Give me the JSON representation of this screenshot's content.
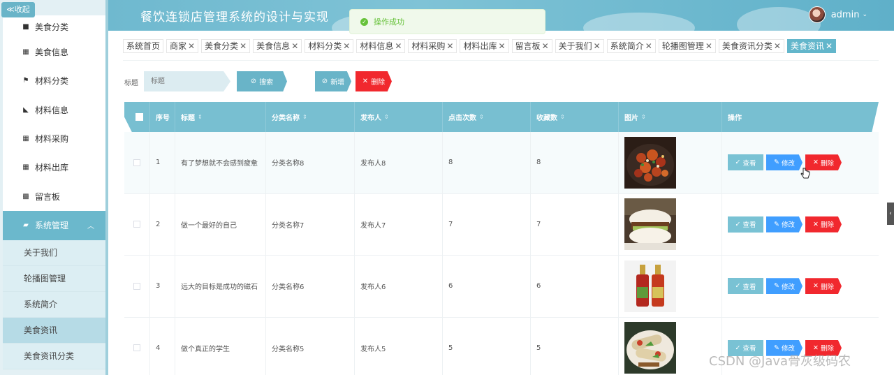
{
  "sidebar": {
    "collapse_label": "≪收起",
    "items": [
      {
        "label": "美食分类",
        "icon": "book-icon"
      },
      {
        "label": "美食信息",
        "icon": "grid-icon"
      },
      {
        "label": "材料分类",
        "icon": "flag-icon"
      },
      {
        "label": "材料信息",
        "icon": "thumb-icon"
      },
      {
        "label": "材料采购",
        "icon": "grid-icon"
      },
      {
        "label": "材料出库",
        "icon": "grid-icon"
      },
      {
        "label": "留言板",
        "icon": "grid3-icon"
      }
    ],
    "group": {
      "label": "系统管理",
      "icon": "briefcase-icon"
    },
    "sub_items": [
      {
        "label": "关于我们"
      },
      {
        "label": "轮播图管理"
      },
      {
        "label": "系统简介"
      },
      {
        "label": "美食资讯"
      },
      {
        "label": "美食资讯分类"
      }
    ]
  },
  "header": {
    "title": "餐饮连锁店管理系统的设计与实现",
    "user": "admin"
  },
  "toast": {
    "message": "操作成功"
  },
  "tabs": [
    {
      "label": "系统首页",
      "closable": false
    },
    {
      "label": "商家",
      "closable": true
    },
    {
      "label": "美食分类",
      "closable": true
    },
    {
      "label": "美食信息",
      "closable": true
    },
    {
      "label": "材料分类",
      "closable": true
    },
    {
      "label": "材料信息",
      "closable": true
    },
    {
      "label": "材料采购",
      "closable": true
    },
    {
      "label": "材料出库",
      "closable": true
    },
    {
      "label": "留言板",
      "closable": true
    },
    {
      "label": "关于我们",
      "closable": true
    },
    {
      "label": "系统简介",
      "closable": true
    },
    {
      "label": "轮播图管理",
      "closable": true
    },
    {
      "label": "美食资讯分类",
      "closable": true
    },
    {
      "label": "美食资讯",
      "closable": true,
      "active": true
    }
  ],
  "search": {
    "label": "标题",
    "placeholder": "标题",
    "search_label": "搜索",
    "add_label": "新增",
    "delete_label": "删除"
  },
  "table": {
    "columns": [
      "序号",
      "标题",
      "分类名称",
      "发布人",
      "点击次数",
      "收藏数",
      "图片",
      "操作"
    ],
    "rows": [
      {
        "index": "1",
        "title": "有了梦想就不会感到疲惫",
        "category": "分类名称8",
        "publisher": "发布人8",
        "clicks": "8",
        "favorites": "8",
        "image": "spicy-chicken"
      },
      {
        "index": "2",
        "title": "做一个最好的自己",
        "category": "分类名称7",
        "publisher": "发布人7",
        "clicks": "7",
        "favorites": "7",
        "image": "steamed-bun"
      },
      {
        "index": "3",
        "title": "远大的目标是成功的磁石",
        "category": "分类名称6",
        "publisher": "发布人6",
        "clicks": "6",
        "favorites": "6",
        "image": "sauce-bottles"
      },
      {
        "index": "4",
        "title": "做个真正的学生",
        "category": "分类名称5",
        "publisher": "发布人5",
        "clicks": "5",
        "favorites": "5",
        "image": "spring-rolls"
      }
    ],
    "actions": {
      "view": "查看",
      "edit": "修改",
      "delete": "删除"
    }
  },
  "watermark": "CSDN @Java骨灰级码农",
  "colors": {
    "primary": "#69b4c8",
    "danger": "#f1282e",
    "edit": "#409eff",
    "success": "#67c23a"
  }
}
